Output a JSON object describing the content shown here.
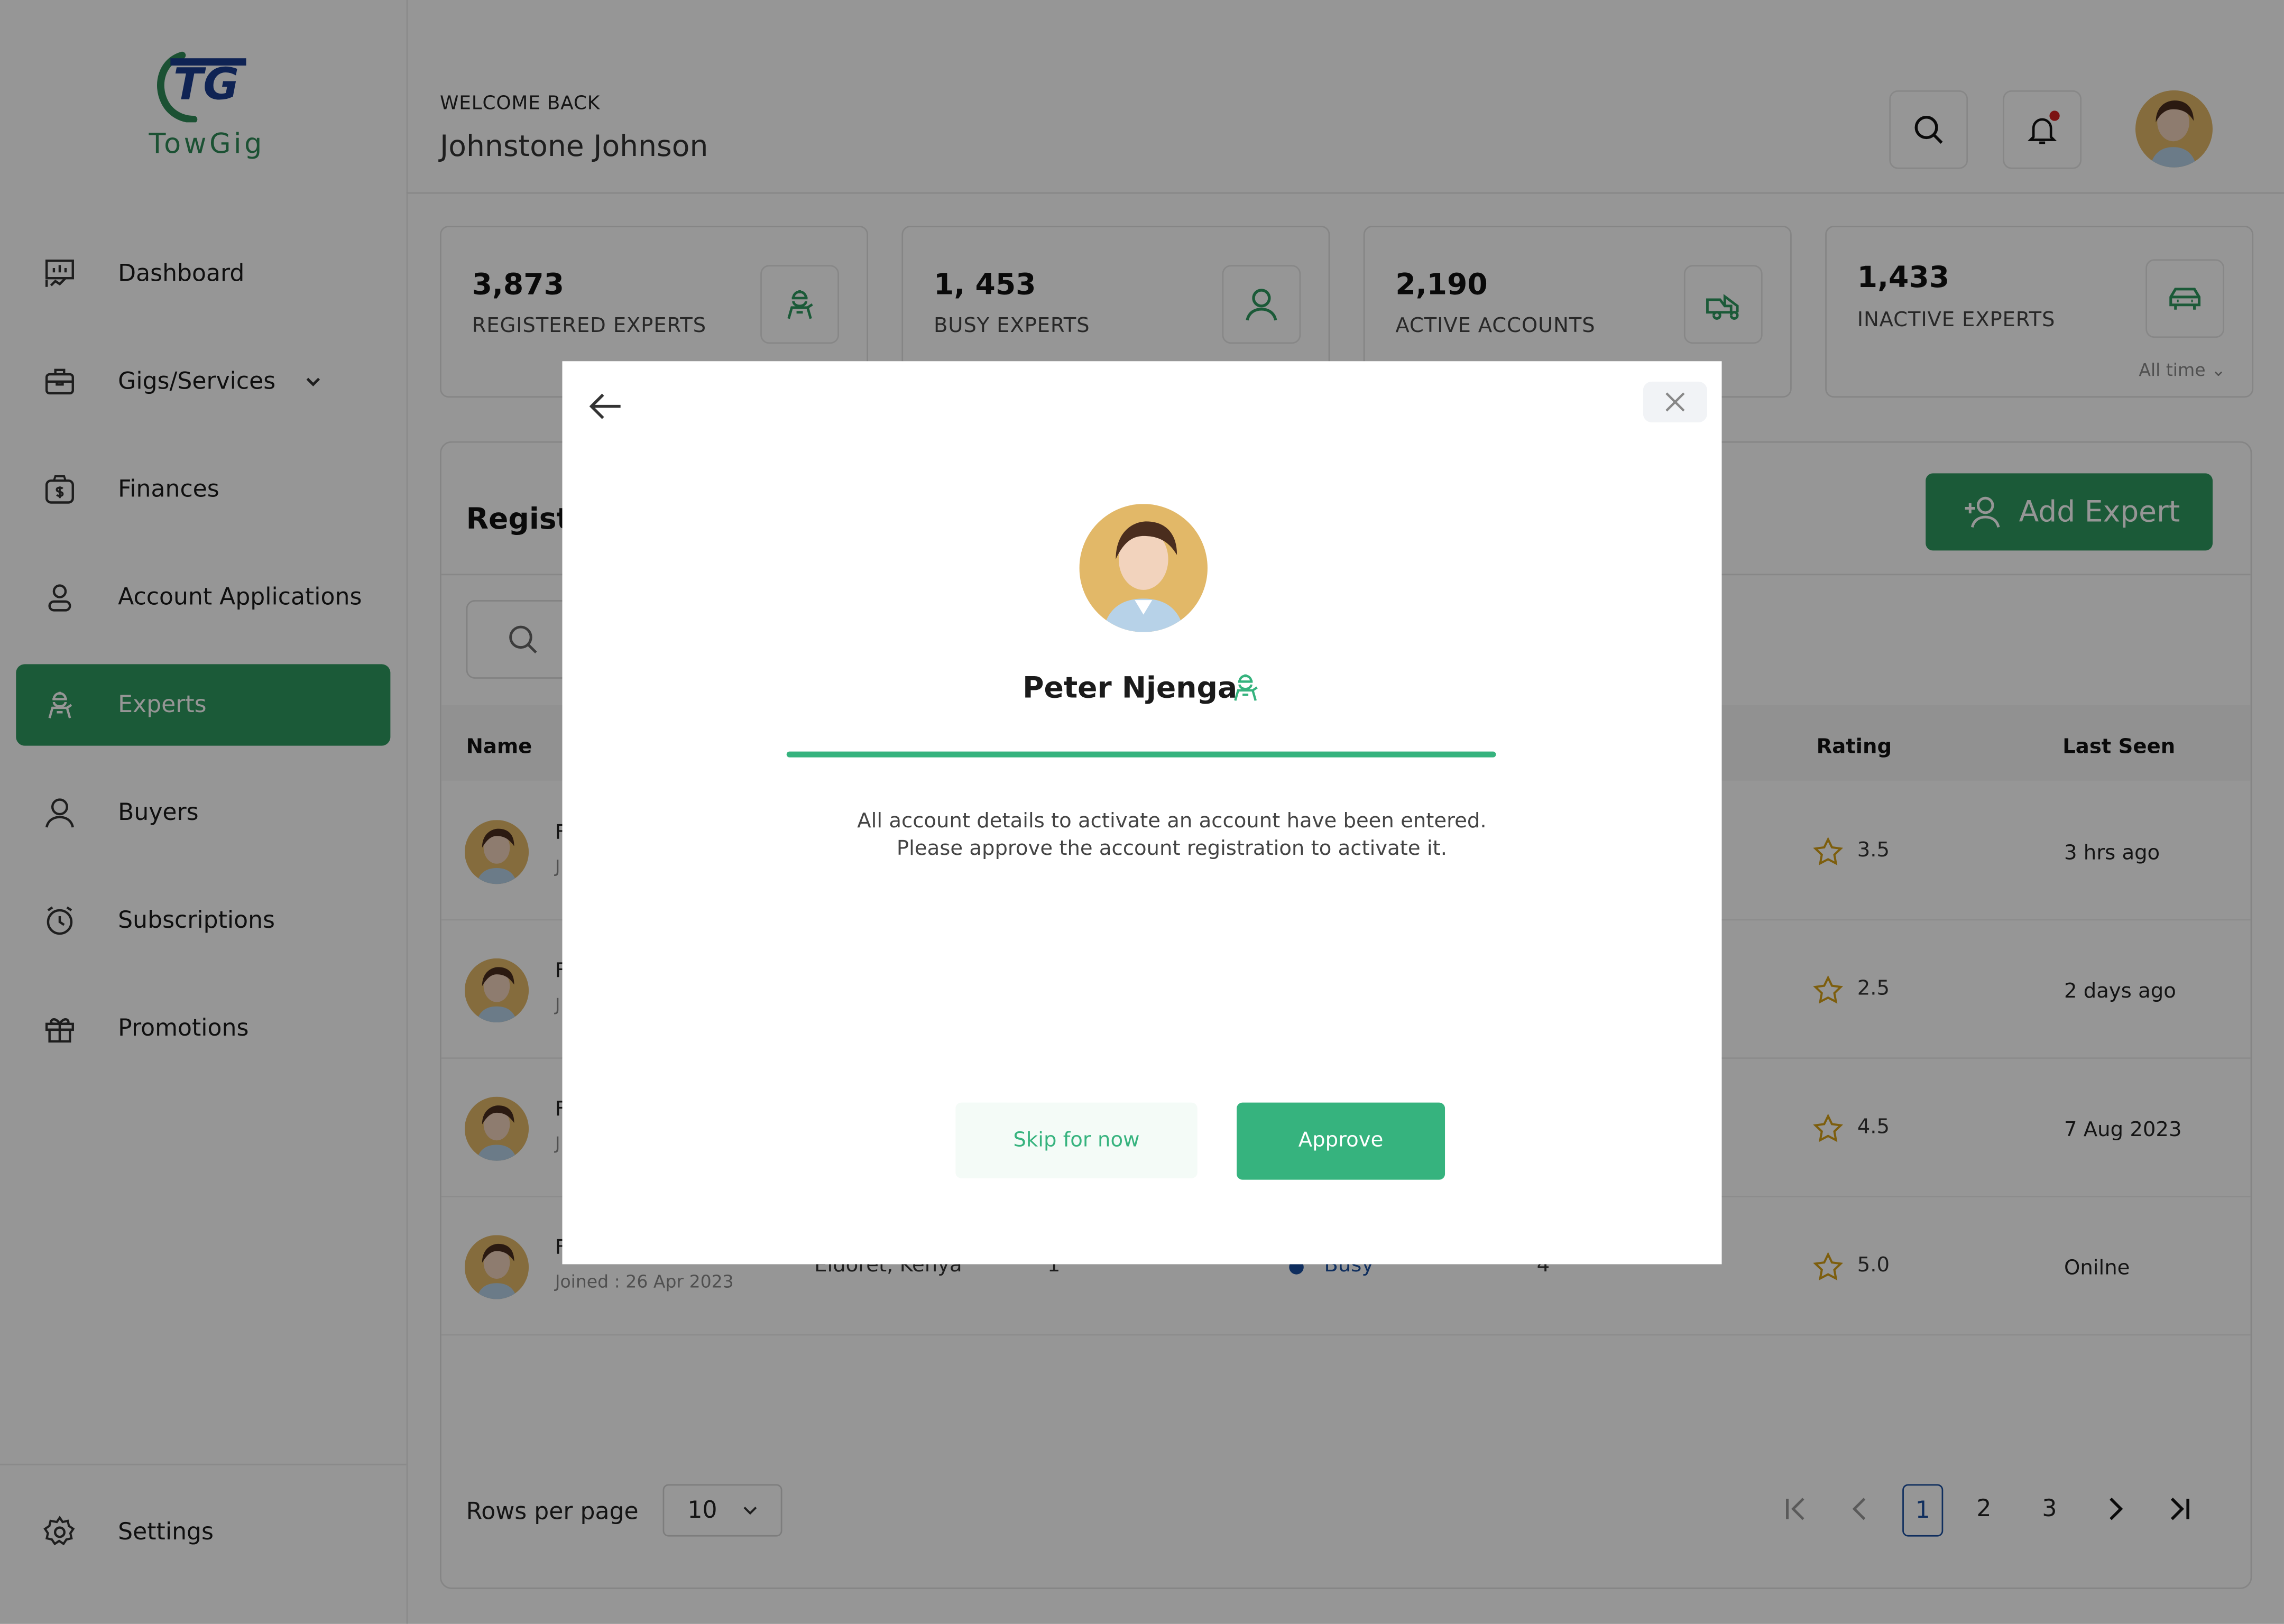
{
  "brand": {
    "name": "TowGig",
    "mark": "TG",
    "primary_color": "#2f9a5f",
    "accent_color": "#36b37e"
  },
  "sidebar": {
    "items": [
      {
        "label": "Dashboard",
        "icon": "dashboard-icon"
      },
      {
        "label": "Gigs/Services",
        "icon": "briefcase-icon",
        "has_dropdown": true
      },
      {
        "label": "Finances",
        "icon": "money-bag-icon"
      },
      {
        "label": "Account Applications",
        "icon": "user-icon"
      },
      {
        "label": "Experts",
        "icon": "mechanic-icon",
        "active": true
      },
      {
        "label": "Buyers",
        "icon": "person-icon"
      },
      {
        "label": "Subscriptions",
        "icon": "alarm-clock-icon"
      },
      {
        "label": "Promotions",
        "icon": "gift-icon"
      }
    ],
    "settings_label": "Settings"
  },
  "header": {
    "welcome": "WELCOME BACK",
    "user_name": "Johnstone Johnson"
  },
  "stats": [
    {
      "value": "3,873",
      "label": "REGISTERED EXPERTS",
      "icon": "mechanic-icon"
    },
    {
      "value": "1, 453",
      "label": "BUSY EXPERTS",
      "icon": "user-icon"
    },
    {
      "value": "2,190",
      "label": "ACTIVE ACCOUNTS",
      "icon": "tow-truck-icon"
    },
    {
      "value": "1,433",
      "label": "INACTIVE EXPERTS",
      "icon": "car-icon",
      "period": "All time"
    }
  ],
  "panel": {
    "title": "Registe",
    "add_button": "Add Expert",
    "columns": {
      "name": "Name",
      "rating": "Rating",
      "last_seen": "Last Seen"
    },
    "rows": [
      {
        "name": "F",
        "joined": "J",
        "rating": "3.5",
        "last_seen": "3 hrs ago"
      },
      {
        "name": "F",
        "joined": "J",
        "rating": "2.5",
        "last_seen": "2 days ago"
      },
      {
        "name": "F",
        "joined": "J",
        "rating": "4.5",
        "last_seen": "7 Aug 2023"
      },
      {
        "name": "F",
        "joined": "Joined : 26 Apr 2023",
        "location": "Eldoret, Kenya",
        "count": "1",
        "status": "Busy",
        "jobs": "4",
        "rating": "5.0",
        "last_seen": "Onilne"
      }
    ],
    "rows_per_page_label": "Rows per page",
    "rows_per_page_value": "10",
    "pages": [
      "1",
      "2",
      "3"
    ],
    "current_page": "1"
  },
  "modal": {
    "name": "Peter Njenga",
    "progress": 1.0,
    "message_line1": "All account details to activate an account have been entered.",
    "message_line2": "Please approve the account registration to activate it.",
    "skip_label": "Skip for now",
    "approve_label": "Approve"
  }
}
